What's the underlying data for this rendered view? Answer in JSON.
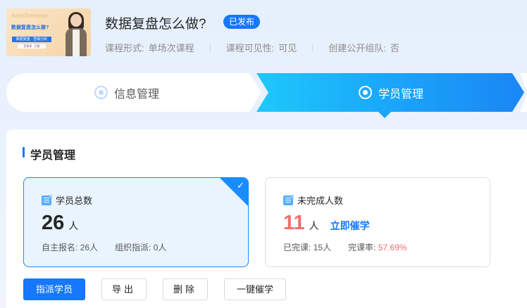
{
  "course": {
    "title": "数据复盘怎么做?",
    "status": "已发布",
    "meta": [
      {
        "label": "课程形式:",
        "value": "单场次课程"
      },
      {
        "label": "课程可见性:",
        "value": "可见"
      },
      {
        "label": "创建公开组队:",
        "value": "否"
      }
    ],
    "thumbnail": {
      "script_text": "Annilkneieee",
      "title_text": "数据复盘怎么做?",
      "tag_text": "数据复盘 · 营销分析",
      "sub_text": "直播课 · 回看"
    }
  },
  "steps": [
    {
      "label": "信息管理",
      "state": "inactive"
    },
    {
      "label": "学员管理",
      "state": "active"
    }
  ],
  "section": {
    "title": "学员管理"
  },
  "cards": {
    "total": {
      "label": "学员总数",
      "value": "26",
      "unit": "人",
      "stats": [
        {
          "label": "自主报名:",
          "value": "26人"
        },
        {
          "label": "组织指派:",
          "value": "0人"
        }
      ],
      "selected": true
    },
    "unfinished": {
      "label": "未完成人数",
      "value": "11",
      "unit": "人",
      "action": "立即催学",
      "stats": [
        {
          "label": "已完课:",
          "value": "15人"
        },
        {
          "label": "完课率:",
          "value": "57.69%"
        }
      ]
    }
  },
  "buttons": {
    "assign": "指派学员",
    "export": "导出",
    "delete": "删除",
    "urge_all": "一键催学"
  },
  "colors": {
    "primary": "#1677ff",
    "accent_red": "#f56c6c",
    "step_gradient_start": "#1ec8fb",
    "step_gradient_end": "#1a86f5"
  }
}
